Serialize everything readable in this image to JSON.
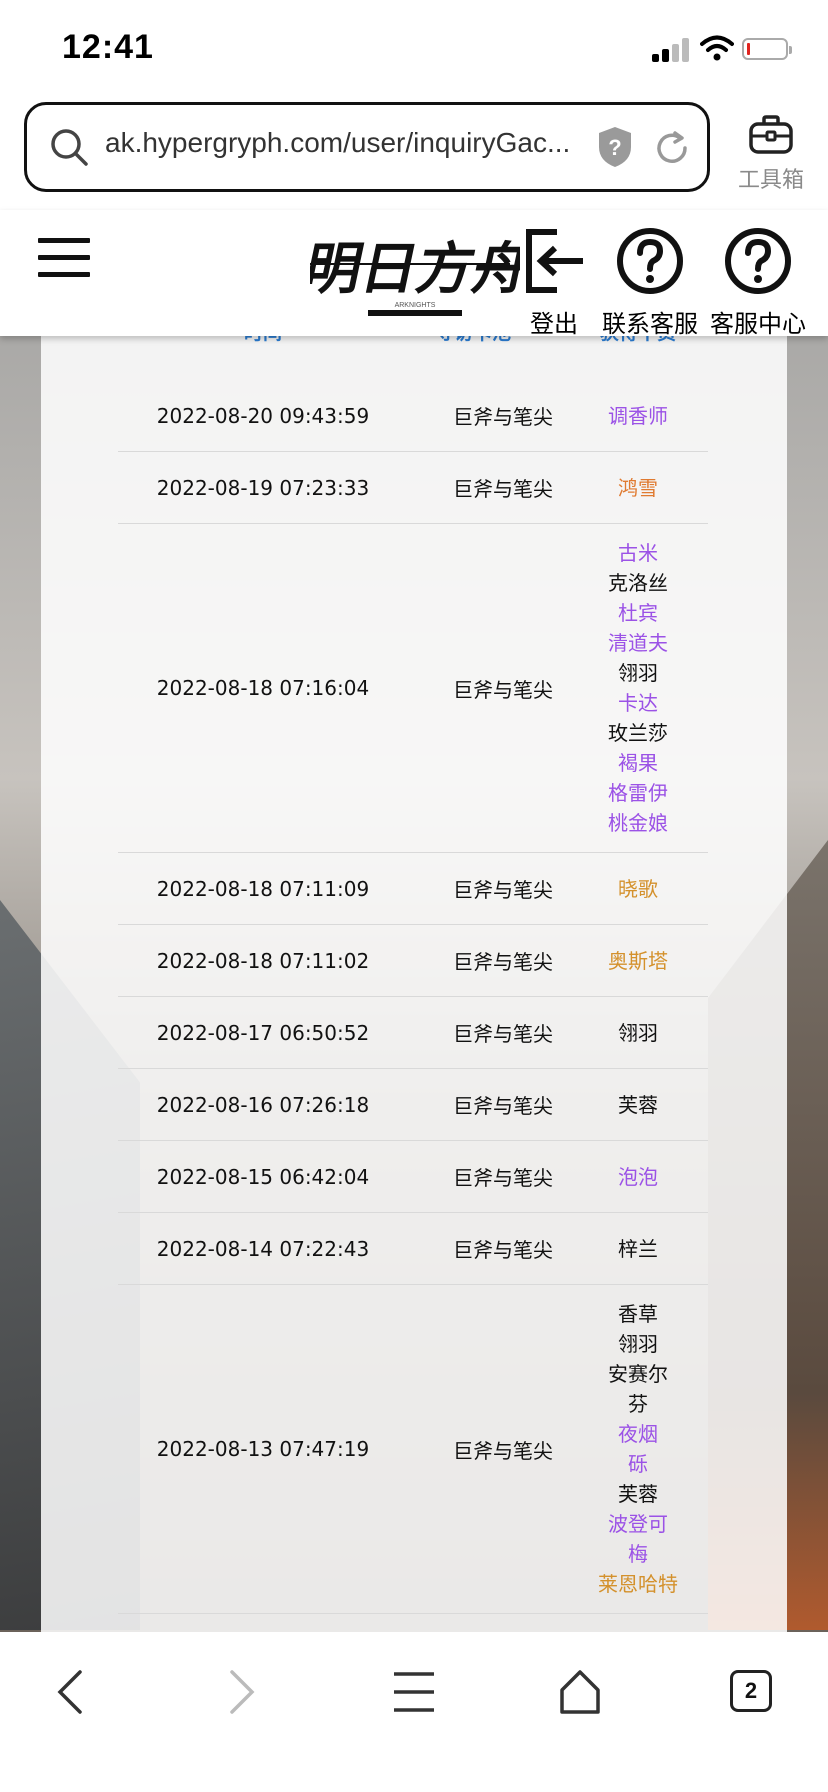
{
  "status_bar": {
    "time": "12:41",
    "icons": [
      "signal-icon",
      "wifi-icon",
      "battery-icon"
    ]
  },
  "browser": {
    "url": "ak.hypergryph.com/user/inquiryGac...",
    "toolbox_label": "工具箱",
    "tabs_count": "2"
  },
  "header": {
    "logo_alt": "明日方舟",
    "logo_sub": "ARKNIGHTS",
    "actions": [
      {
        "label": "登出",
        "icon": "logout-icon"
      },
      {
        "label": "联系客服",
        "icon": "help-circle-icon"
      },
      {
        "label": "客服中心",
        "icon": "help-circle-icon"
      }
    ]
  },
  "table": {
    "columns": [
      "时间",
      "寻访卡池",
      "获得干员"
    ],
    "colors": {
      "purple": "#9b52e6",
      "orange": "#e07a30",
      "gold": "#d4912c",
      "blue": "#2a7bd0",
      "black": "#111111"
    },
    "rows": [
      {
        "time": "2022-08-20 09:43:59",
        "pool": "巨斧与笔尖",
        "ops": [
          {
            "name": "调香师",
            "rarity": "purple"
          }
        ]
      },
      {
        "time": "2022-08-19 07:23:33",
        "pool": "巨斧与笔尖",
        "ops": [
          {
            "name": "鸿雪",
            "rarity": "orange"
          }
        ]
      },
      {
        "time": "2022-08-18 07:16:04",
        "pool": "巨斧与笔尖",
        "ops": [
          {
            "name": "古米",
            "rarity": "purple"
          },
          {
            "name": "克洛丝",
            "rarity": "black"
          },
          {
            "name": "杜宾",
            "rarity": "purple"
          },
          {
            "name": "清道夫",
            "rarity": "purple"
          },
          {
            "name": "翎羽",
            "rarity": "black"
          },
          {
            "name": "卡达",
            "rarity": "purple"
          },
          {
            "name": "玫兰莎",
            "rarity": "black"
          },
          {
            "name": "褐果",
            "rarity": "purple"
          },
          {
            "name": "格雷伊",
            "rarity": "purple"
          },
          {
            "name": "桃金娘",
            "rarity": "purple"
          }
        ]
      },
      {
        "time": "2022-08-18 07:11:09",
        "pool": "巨斧与笔尖",
        "ops": [
          {
            "name": "晓歌",
            "rarity": "gold"
          }
        ]
      },
      {
        "time": "2022-08-18 07:11:02",
        "pool": "巨斧与笔尖",
        "ops": [
          {
            "name": "奥斯塔",
            "rarity": "gold"
          }
        ]
      },
      {
        "time": "2022-08-17 06:50:52",
        "pool": "巨斧与笔尖",
        "ops": [
          {
            "name": "翎羽",
            "rarity": "black"
          }
        ]
      },
      {
        "time": "2022-08-16 07:26:18",
        "pool": "巨斧与笔尖",
        "ops": [
          {
            "name": "芙蓉",
            "rarity": "black"
          }
        ]
      },
      {
        "time": "2022-08-15 06:42:04",
        "pool": "巨斧与笔尖",
        "ops": [
          {
            "name": "泡泡",
            "rarity": "purple"
          }
        ]
      },
      {
        "time": "2022-08-14 07:22:43",
        "pool": "巨斧与笔尖",
        "ops": [
          {
            "name": "梓兰",
            "rarity": "black"
          }
        ]
      },
      {
        "time": "2022-08-13 07:47:19",
        "pool": "巨斧与笔尖",
        "ops": [
          {
            "name": "香草",
            "rarity": "black"
          },
          {
            "name": "翎羽",
            "rarity": "black"
          },
          {
            "name": "安赛尔",
            "rarity": "black"
          },
          {
            "name": "芬",
            "rarity": "black"
          },
          {
            "name": "夜烟",
            "rarity": "purple"
          },
          {
            "name": "砾",
            "rarity": "purple"
          },
          {
            "name": "芙蓉",
            "rarity": "black"
          },
          {
            "name": "波登可",
            "rarity": "purple"
          },
          {
            "name": "梅",
            "rarity": "purple"
          },
          {
            "name": "莱恩哈特",
            "rarity": "gold"
          }
        ]
      }
    ]
  },
  "bottom_nav": [
    "back-icon",
    "forward-icon",
    "menu-list-icon",
    "home-icon",
    "tabs-icon"
  ]
}
